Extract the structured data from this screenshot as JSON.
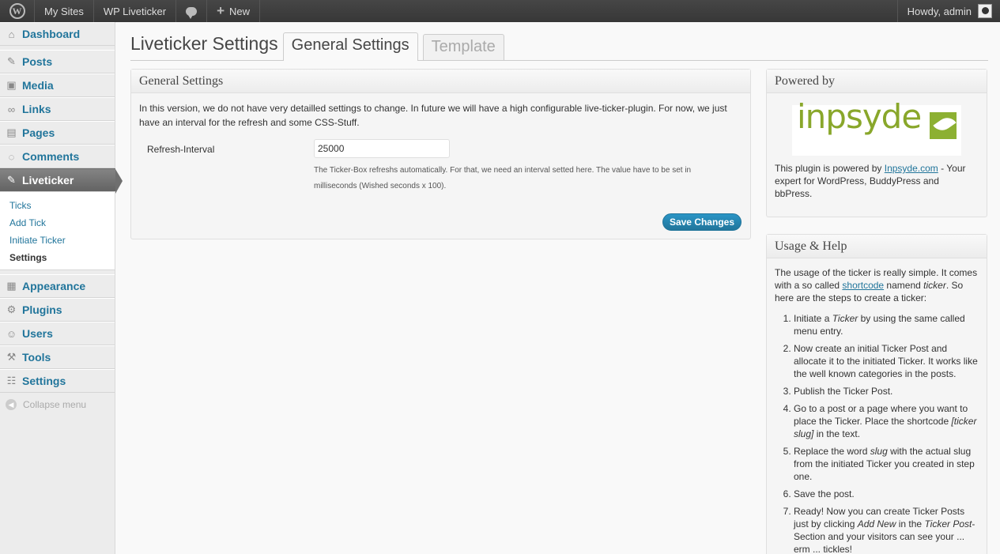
{
  "adminbar": {
    "my_sites": "My Sites",
    "site_name": "WP Liveticker",
    "new_label": "New",
    "howdy": "Howdy, admin"
  },
  "sidebar": {
    "items_top": [
      {
        "label": "Dashboard",
        "icon": "dashboard-icon"
      }
    ],
    "items_mid": [
      {
        "label": "Posts",
        "icon": "pin-icon"
      },
      {
        "label": "Media",
        "icon": "media-icon"
      },
      {
        "label": "Links",
        "icon": "link-icon"
      },
      {
        "label": "Pages",
        "icon": "pages-icon"
      },
      {
        "label": "Comments",
        "icon": "comment-icon"
      }
    ],
    "current": "Liveticker",
    "submenu": [
      "Ticks",
      "Add Tick",
      "Initiate Ticker",
      "Settings"
    ],
    "items_bottom": [
      {
        "label": "Appearance",
        "icon": "appearance-icon"
      },
      {
        "label": "Plugins",
        "icon": "plugin-icon"
      },
      {
        "label": "Users",
        "icon": "users-icon"
      },
      {
        "label": "Tools",
        "icon": "tools-icon"
      },
      {
        "label": "Settings",
        "icon": "settings-icon"
      }
    ],
    "collapse": "Collapse menu"
  },
  "main": {
    "title": "Liveticker Settings",
    "tabs": [
      "General Settings",
      "Template"
    ],
    "general": {
      "heading": "General Settings",
      "intro": "In this version, we do not have very detailled settings to change. In future we will have a high configurable live-ticker-plugin. For now, we just have an interval for the refresh and some CSS-Stuff.",
      "field_label": "Refresh-Interval",
      "field_value": "25000",
      "field_desc": "The Ticker-Box refreshs automatically. For that, we need an interval setted here. The value have to be set in milliseconds (Wished seconds x 100).",
      "save": "Save Changes"
    }
  },
  "powered": {
    "heading": "Powered by",
    "logo_text": "inpsyde",
    "text_before": "This plugin is powered by ",
    "link": "Inpsyde.com",
    "text_after": " - Your expert for WordPress, BuddyPress and bbPress."
  },
  "usage": {
    "heading": "Usage & Help",
    "intro_1": "The usage of the ticker is really simple. It comes with a so called ",
    "intro_link": "shortcode",
    "intro_2": " namend ",
    "intro_em": "ticker",
    "intro_3": ". So here are the steps to create a ticker:",
    "step1": [
      "Initiate a ",
      "Ticker",
      " by using the same called menu entry."
    ],
    "step2": "Now create an initial Ticker Post and allocate it to the initiated Ticker. It works like the well known categories in the posts.",
    "step3": "Publish the Ticker Post.",
    "step4": [
      "Go to a post or a page where you want to place the Ticker. Place the shortcode ",
      "[ticker slug]",
      " in the text."
    ],
    "step5": [
      "Replace the word ",
      "slug",
      " with the actual slug from the initiated Ticker you created in step one."
    ],
    "step6": "Save the post.",
    "step7": [
      "Ready! Now you can create Ticker Posts just by clicking ",
      "Add New",
      " in the ",
      "Ticker Post",
      "-Section and your visitors can see your ... erm ... tickles!"
    ]
  }
}
